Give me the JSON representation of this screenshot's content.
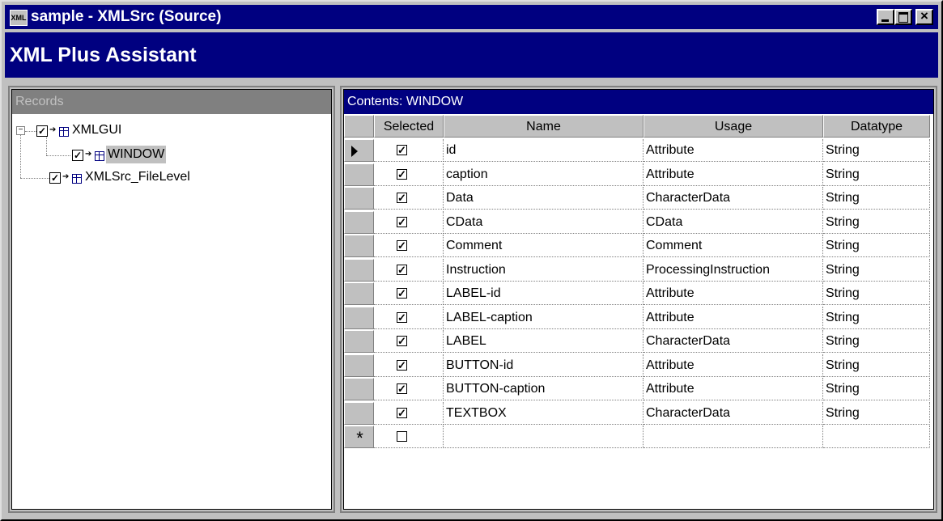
{
  "window": {
    "title": "sample - XMLSrc (Source)",
    "app_icon": "xml-document-icon"
  },
  "header": {
    "title": "XML Plus Assistant"
  },
  "records": {
    "label": "Records",
    "tree": [
      {
        "label": "XMLGUI",
        "checked": true,
        "expanded": true
      },
      {
        "label": "WINDOW",
        "checked": true,
        "selected": true
      },
      {
        "label": "XMLSrc_FileLevel",
        "checked": true
      }
    ]
  },
  "contents": {
    "title": "Contents: WINDOW",
    "columns": [
      "Selected",
      "Name",
      "Usage",
      "Datatype"
    ],
    "rows": [
      {
        "selected": true,
        "name": "id",
        "usage": "Attribute",
        "datatype": "String"
      },
      {
        "selected": true,
        "name": "caption",
        "usage": "Attribute",
        "datatype": "String"
      },
      {
        "selected": true,
        "name": "Data",
        "usage": "CharacterData",
        "datatype": "String"
      },
      {
        "selected": true,
        "name": "CData",
        "usage": "CData",
        "datatype": "String"
      },
      {
        "selected": true,
        "name": "Comment",
        "usage": "Comment",
        "datatype": "String"
      },
      {
        "selected": true,
        "name": "Instruction",
        "usage": "ProcessingInstruction",
        "datatype": "String"
      },
      {
        "selected": true,
        "name": "LABEL-id",
        "usage": "Attribute",
        "datatype": "String"
      },
      {
        "selected": true,
        "name": "LABEL-caption",
        "usage": "Attribute",
        "datatype": "String"
      },
      {
        "selected": true,
        "name": "LABEL",
        "usage": "CharacterData",
        "datatype": "String"
      },
      {
        "selected": true,
        "name": "BUTTON-id",
        "usage": "Attribute",
        "datatype": "String"
      },
      {
        "selected": true,
        "name": "BUTTON-caption",
        "usage": "Attribute",
        "datatype": "String"
      },
      {
        "selected": true,
        "name": "TEXTBOX",
        "usage": "CharacterData",
        "datatype": "String"
      }
    ],
    "new_row_marker": "*"
  }
}
